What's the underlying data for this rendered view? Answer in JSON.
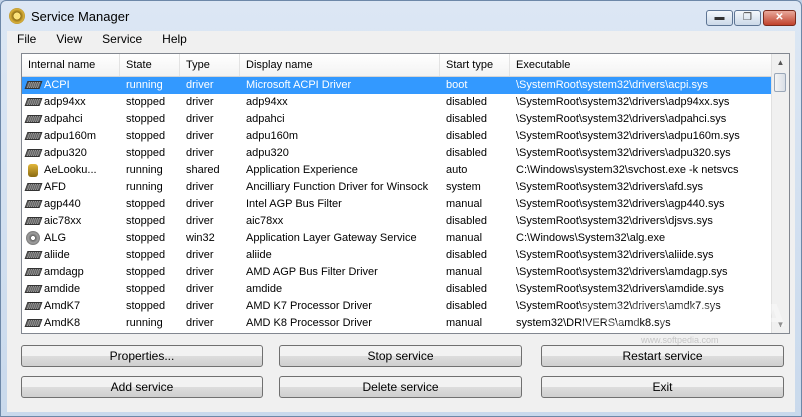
{
  "window": {
    "title": "Service Manager",
    "minimize": "▬",
    "maximize": "❐",
    "close": "✕"
  },
  "menu": [
    "File",
    "View",
    "Service",
    "Help"
  ],
  "columns": [
    "Internal name",
    "State",
    "Type",
    "Display name",
    "Start type",
    "Executable"
  ],
  "rows": [
    {
      "name": "ACPI",
      "state": "running",
      "type": "driver",
      "display": "Microsoft ACPI Driver",
      "start": "boot",
      "exe": "\\SystemRoot\\system32\\drivers\\acpi.sys",
      "icon": "driver-icon",
      "selected": true
    },
    {
      "name": "adp94xx",
      "state": "stopped",
      "type": "driver",
      "display": "adp94xx",
      "start": "disabled",
      "exe": "\\SystemRoot\\system32\\drivers\\adp94xx.sys",
      "icon": "driver-icon"
    },
    {
      "name": "adpahci",
      "state": "stopped",
      "type": "driver",
      "display": "adpahci",
      "start": "disabled",
      "exe": "\\SystemRoot\\system32\\drivers\\adpahci.sys",
      "icon": "driver-icon"
    },
    {
      "name": "adpu160m",
      "state": "stopped",
      "type": "driver",
      "display": "adpu160m",
      "start": "disabled",
      "exe": "\\SystemRoot\\system32\\drivers\\adpu160m.sys",
      "icon": "driver-icon"
    },
    {
      "name": "adpu320",
      "state": "stopped",
      "type": "driver",
      "display": "adpu320",
      "start": "disabled",
      "exe": "\\SystemRoot\\system32\\drivers\\adpu320.sys",
      "icon": "driver-icon"
    },
    {
      "name": "AeLooku...",
      "state": "running",
      "type": "shared",
      "display": "Application Experience",
      "start": "auto",
      "exe": "C:\\Windows\\system32\\svchost.exe -k netsvcs",
      "icon": "shared-service-icon"
    },
    {
      "name": "AFD",
      "state": "running",
      "type": "driver",
      "display": "Ancilliary Function Driver for Winsock",
      "start": "system",
      "exe": "\\SystemRoot\\system32\\drivers\\afd.sys",
      "icon": "driver-icon"
    },
    {
      "name": "agp440",
      "state": "stopped",
      "type": "driver",
      "display": "Intel AGP Bus Filter",
      "start": "manual",
      "exe": "\\SystemRoot\\system32\\drivers\\agp440.sys",
      "icon": "driver-icon"
    },
    {
      "name": "aic78xx",
      "state": "stopped",
      "type": "driver",
      "display": "aic78xx",
      "start": "disabled",
      "exe": "\\SystemRoot\\system32\\drivers\\djsvs.sys",
      "icon": "driver-icon"
    },
    {
      "name": "ALG",
      "state": "stopped",
      "type": "win32",
      "display": "Application Layer Gateway Service",
      "start": "manual",
      "exe": "C:\\Windows\\System32\\alg.exe",
      "icon": "win32-service-icon"
    },
    {
      "name": "aliide",
      "state": "stopped",
      "type": "driver",
      "display": "aliide",
      "start": "disabled",
      "exe": "\\SystemRoot\\system32\\drivers\\aliide.sys",
      "icon": "driver-icon"
    },
    {
      "name": "amdagp",
      "state": "stopped",
      "type": "driver",
      "display": "AMD AGP Bus Filter Driver",
      "start": "manual",
      "exe": "\\SystemRoot\\system32\\drivers\\amdagp.sys",
      "icon": "driver-icon"
    },
    {
      "name": "amdide",
      "state": "stopped",
      "type": "driver",
      "display": "amdide",
      "start": "disabled",
      "exe": "\\SystemRoot\\system32\\drivers\\amdide.sys",
      "icon": "driver-icon"
    },
    {
      "name": "AmdK7",
      "state": "stopped",
      "type": "driver",
      "display": "AMD K7 Processor Driver",
      "start": "disabled",
      "exe": "\\SystemRoot\\system32\\drivers\\amdk7.sys",
      "icon": "driver-icon"
    },
    {
      "name": "AmdK8",
      "state": "running",
      "type": "driver",
      "display": "AMD K8 Processor Driver",
      "start": "manual",
      "exe": "system32\\DRIVERS\\amdk8.sys",
      "icon": "driver-icon"
    }
  ],
  "buttons": {
    "properties": "Properties...",
    "stop": "Stop service",
    "restart": "Restart service",
    "add": "Add service",
    "delete": "Delete service",
    "exit": "Exit"
  },
  "scrollbar": {
    "up": "▲",
    "down": "▼"
  },
  "watermark": {
    "text": "SOFTPEDIA",
    "url": "www.softpedia.com"
  }
}
